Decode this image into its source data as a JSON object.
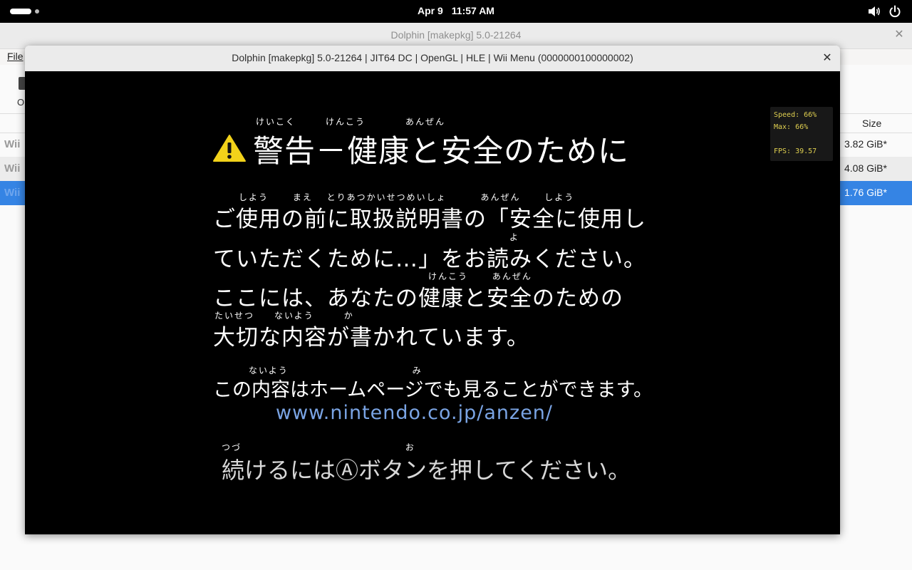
{
  "topbar": {
    "date": "Apr 9",
    "time": "11:57 AM"
  },
  "main_window": {
    "title": "Dolphin [makepkg] 5.0-21264",
    "menu_file": "File",
    "toolbar_open_label": "O",
    "size_column": "Size",
    "rows": [
      {
        "platform": "Wii",
        "size": "3.82 GiB*"
      },
      {
        "platform": "Wii",
        "size": "4.08 GiB*"
      },
      {
        "platform": "Wii",
        "size": "1.76 GiB*"
      }
    ]
  },
  "render_window": {
    "title": "Dolphin [makepkg] 5.0-21264 | JIT64 DC | OpenGL | HLE | Wii Menu (0000000100000002)"
  },
  "perf_overlay": {
    "speed": "Speed:  66%",
    "max": "Max:    66%",
    "fps": "FPS:  39.57"
  },
  "game_screen": {
    "heading_furigana": "けいこく　　　けんこう　　　　あんぜん",
    "heading": "警告－健康と安全のために",
    "line1_furigana": "しよう　　 まえ　 とりあつかいせつめいしょ　　　 あんぜん　　 しよう",
    "line1": "ご使用の前に取扱説明書の「安全に使用し",
    "line2_furigana": "よ",
    "line2": "ていただくために…」をお読みください。",
    "line3_furigana": "けんこう　　 あんぜん",
    "line3": "ここには、あなたの健康と安全のための",
    "line4_furigana": "たいせつ　　ないよう　　　か",
    "line4": "大切な内容が書かれています。",
    "line5_furigana": "ないよう　　　　　　　　　　　　 み",
    "line5": "この内容はホームページでも見ることができます。",
    "url": "www.nintendo.co.jp/anzen/",
    "line6_furigana": "つづ　　　　　　　　　　　　　　　　 お",
    "line6": "続けるにはⒶボタンを押してください。"
  },
  "colors": {
    "selection": "#3584e4",
    "url": "#7aa4e4",
    "overlay_text": "#e0d050",
    "warning": "#f2d21a"
  }
}
